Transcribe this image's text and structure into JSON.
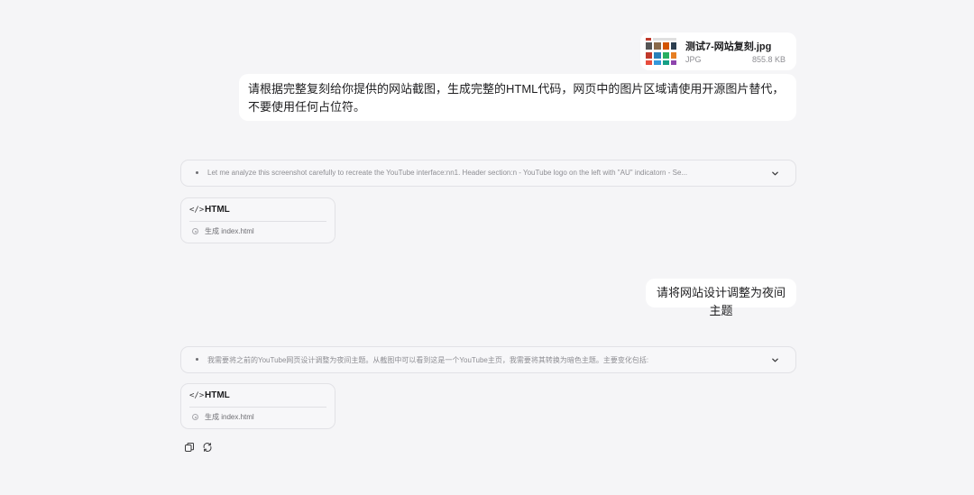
{
  "attachment": {
    "file_name": "测试7-网站复刻.jpg",
    "file_type": "JPG",
    "file_size": "855.8 KB",
    "icon": "image-thumbnail-icon"
  },
  "messages": [
    {
      "role": "user",
      "text": "请根据完整复刻给你提供的网站截图，生成完整的HTML代码，网页中的图片区域请使用开源图片替代，不要使用任何占位符。"
    },
    {
      "role": "user",
      "text": "请将网站设计调整为夜间主题"
    }
  ],
  "thoughts": [
    {
      "text": "Let me analyze this screenshot carefully to recreate the YouTube interface:nn1. Header section:n - YouTube logo on the left with \"AU\" indicatorn - Se...",
      "icon": "chevron-down-icon"
    },
    {
      "text": "我需要将之前的YouTube网页设计调整为夜间主题。从截图中可以看到这是一个YouTube主页，我需要将其转换为暗色主题。主要变化包括:",
      "icon": "chevron-down-icon"
    }
  ],
  "artifacts": [
    {
      "icon_glyph": "</>",
      "name": "HTML",
      "status": "生成 index.html"
    },
    {
      "icon_glyph": "</>",
      "name": "HTML",
      "status": "生成 index.html"
    }
  ],
  "actions": {
    "copy_icon": "copy-icon",
    "retry_icon": "refresh-icon"
  },
  "colors": {
    "background": "#f5f5f7",
    "bubble": "#ffffff",
    "muted": "#8e8e93"
  }
}
